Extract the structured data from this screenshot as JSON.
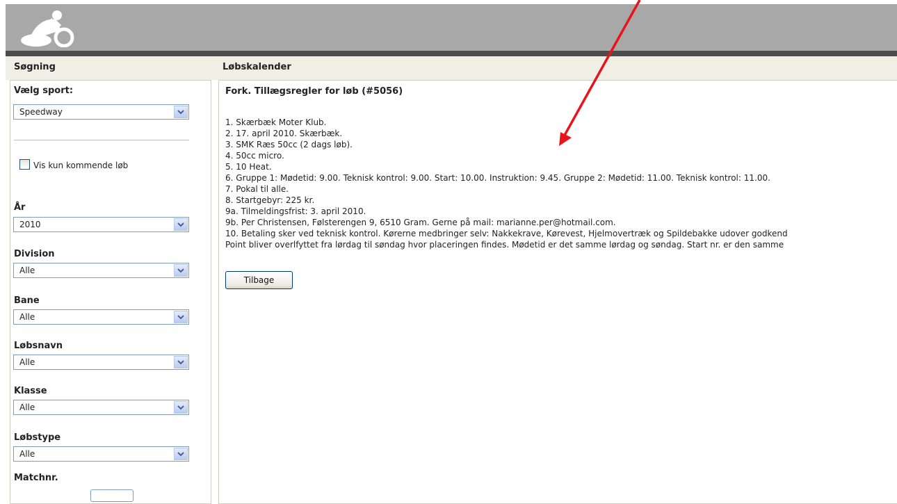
{
  "header": {
    "logo_icon": "motorcycle-rider-logo"
  },
  "sidebar": {
    "title": "Søgning",
    "sport_label": "Vælg sport:",
    "sport_value": "Speedway",
    "checkbox_label": "Vis kun kommende løb",
    "year_label": "År",
    "year_value": "2010",
    "division_label": "Division",
    "division_value": "Alle",
    "bane_label": "Bane",
    "bane_value": "Alle",
    "race_name_label": "Løbsnavn",
    "race_name_value": "Alle",
    "class_label": "Klasse",
    "class_value": "Alle",
    "race_type_label": "Løbstype",
    "race_type_value": "Alle",
    "match_label": "Matchnr."
  },
  "main": {
    "title": "Løbskalender",
    "rules_title": "Fork. Tillægsregler for løb (#5056)",
    "lines": [
      "1. Skærbæk Moter Klub.",
      "2. 17. april 2010. Skærbæk.",
      "3. SMK Ræs 50cc (2 dags løb).",
      "4. 50cc micro.",
      "5. 10 Heat.",
      "6. Gruppe 1: Mødetid: 9.00. Teknisk kontrol: 9.00. Start: 10.00. Instruktion: 9.45. Gruppe 2: Mødetid: 11.00. Teknisk kontrol: 11.00.",
      "7. Pokal til alle.",
      "8. Startgebyr: 225 kr.",
      "9a. Tilmeldingsfrist: 3. april 2010.",
      "9b. Per Christensen, Følsterengen 9, 6510 Gram. Gerne på mail: marianne.per@hotmail.com.",
      "10. Betaling sker ved teknisk kontrol. Kørerne medbringer selv: Nakkekrave, Kørevest, Hjelmovertræk og Spildebakke udover godkend",
      "Point bliver overlfyttet fra lørdag til søndag hvor placeringen findes. Mødetid er det samme lørdag og søndag. Start nr. er den samme"
    ],
    "back_button": "Tilbage"
  },
  "colors": {
    "annotation_arrow": "#e8141b",
    "header_gray": "#a8a8a8",
    "dark_bar": "#4d4d4d"
  }
}
